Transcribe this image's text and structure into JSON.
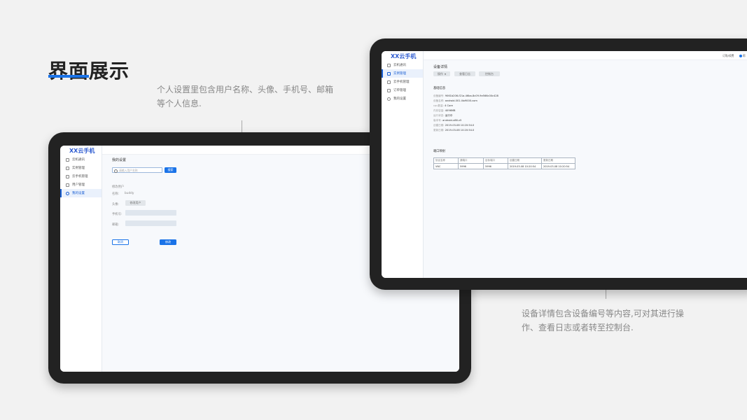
{
  "heading": "界面展示",
  "caption_settings": "个人设置里包含用户名称、头像、手机号、邮箱等个人信息.",
  "caption_detail": "设备详情包含设备编号等内容,可对其进行操作、查看日志或者转至控制台.",
  "app_name": "XX云手机",
  "settings_screen": {
    "nav": [
      "云机通讯",
      "实例管理",
      "云手机管理",
      "用户管理",
      "我的设置"
    ],
    "active_index": 4,
    "breadcrumb": "我的设置",
    "search_placeholder": "请输入用户名称",
    "search_button": "搜索",
    "section_title": "修改用户",
    "name_label": "名称:",
    "name_value": "buddy",
    "avatar_label": "头像:",
    "avatar_button": "修改用户",
    "phone_label": "手机号:",
    "email_label": "邮箱:",
    "cancel_button": "取消",
    "submit_button": "修改"
  },
  "detail_screen": {
    "nav": [
      "云机通讯",
      "实例管理",
      "云手机管理",
      "订单管理",
      "我的设置"
    ],
    "active_index": 1,
    "top_right_link": "订购/续费",
    "top_right_help": "帮",
    "breadcrumb": "设备详情",
    "actions": [
      "操作",
      "查看日志",
      "控制台"
    ],
    "basic_info_title": "基础信息",
    "basic_info": [
      {
        "k": "设备编号:",
        "v": "9061b206-f21a-46ba-8c09-9e566c00c428"
      },
      {
        "k": "设备名称:",
        "v": "android-001.lilo9000.com"
      },
      {
        "k": "cpu数量:",
        "v": "4 Core"
      },
      {
        "k": "内存容量:",
        "v": "4096MB"
      },
      {
        "k": "运行状态:",
        "v": "运行中"
      },
      {
        "k": "版本号:",
        "v": "android-x86.v5"
      },
      {
        "k": "创建日期:",
        "v": "2019-03-08 10:20:54.0"
      },
      {
        "k": "更新日期:",
        "v": "2019-03-08 10:20:54.0"
      }
    ],
    "ports_title": "端口映射",
    "ports_columns": [
      "协议名称",
      "源端口",
      "目标端口",
      "创建日期",
      "更新日期"
    ],
    "ports_rows": [
      [
        "VNC",
        "5996",
        "5996",
        "2019-03-08 10:20:54",
        "2019-03-08 10:20:54"
      ]
    ]
  }
}
